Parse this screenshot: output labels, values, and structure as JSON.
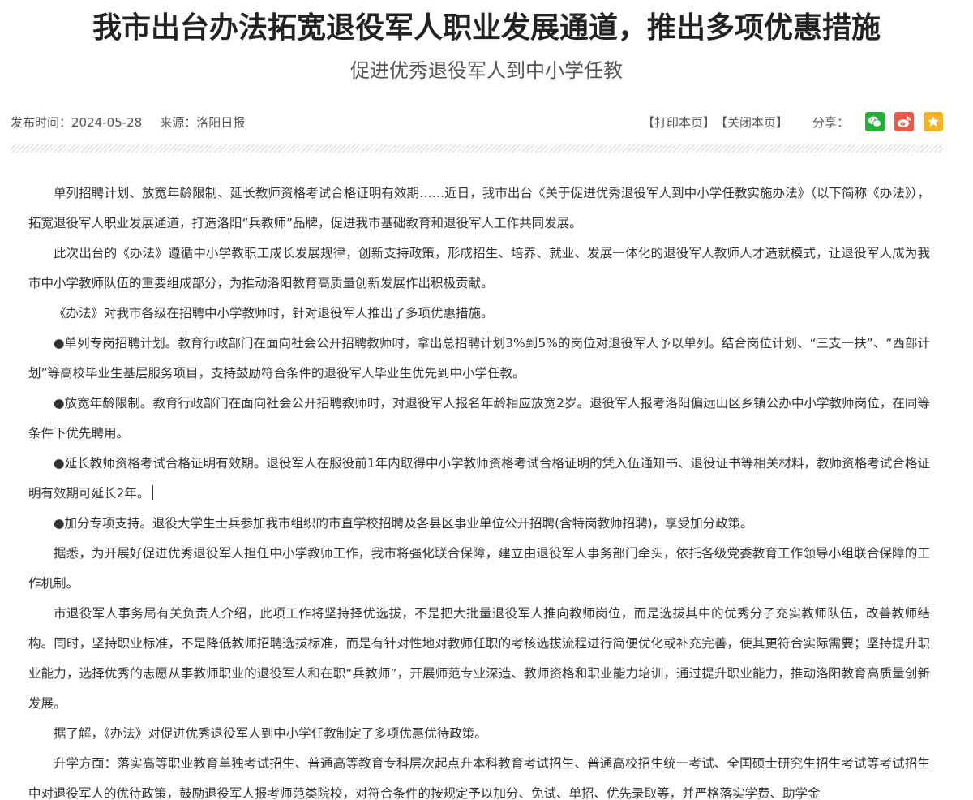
{
  "article": {
    "title": "我市出台办法拓宽退役军人职业发展通道，推出多项优惠措施",
    "subtitle": "促进优秀退役军人到中小学任教",
    "meta": {
      "publish_time": "发布时间：2024-05-28",
      "source": "来源：洛阳日报"
    },
    "actions": {
      "print": "【打印本页】",
      "close": "【关闭本页】",
      "share_label": "分享："
    },
    "paragraphs": [
      "单列招聘计划、放宽年龄限制、延长教师资格考试合格证明有效期……近日，我市出台《关于促进优秀退役军人到中小学任教实施办法》（以下简称《办法》），拓宽退役军人职业发展通道，打造洛阳“兵教师”品牌，促进我市基础教育和退役军人工作共同发展。",
      "此次出台的《办法》遵循中小学教职工成长发展规律，创新支持政策，形成招生、培养、就业、发展一体化的退役军人教师人才造就模式，让退役军人成为我市中小学教师队伍的重要组成部分，为推动洛阳教育高质量创新发展作出积极贡献。",
      "《办法》对我市各级在招聘中小学教师时，针对退役军人推出了多项优惠措施。",
      "●单列专岗招聘计划。教育行政部门在面向社会公开招聘教师时，拿出总招聘计划3%到5%的岗位对退役军人予以单列。结合岗位计划、“三支一扶”、“西部计划”等高校毕业生基层服务项目，支持鼓励符合条件的退役军人毕业生优先到中小学任教。",
      "●放宽年龄限制。教育行政部门在面向社会公开招聘教师时，对退役军人报名年龄相应放宽2岁。退役军人报考洛阳偏远山区乡镇公办中小学教师岗位，在同等条件下优先聘用。",
      "●延长教师资格考试合格证明有效期。退役军人在服役前1年内取得中小学教师资格考试合格证明的凭入伍通知书、退役证书等相关材料，教师资格考试合格证明有效期可延长2年。",
      "●加分专项支持。退役大学生士兵参加我市组织的市直学校招聘及各县区事业单位公开招聘(含特岗教师招聘)，享受加分政策。",
      "据悉，为开展好促进优秀退役军人担任中小学教师工作，我市将强化联合保障，建立由退役军人事务部门牵头，依托各级党委教育工作领导小组联合保障的工作机制。",
      "市退役军人事务局有关负责人介绍，此项工作将坚持择优选拔，不是把大批量退役军人推向教师岗位，而是选拔其中的优秀分子充实教师队伍，改善教师结构。同时，坚持职业标准，不是降低教师招聘选拔标准，而是有针对性地对教师任职的考核选拔流程进行简便优化或补充完善，使其更符合实际需要；坚持提升职业能力，选择优秀的志愿从事教师职业的退役军人和在职“兵教师”，开展师范专业深造、教师资格和职业能力培训，通过提升职业能力，推动洛阳教育高质量创新发展。",
      "据了解，《办法》对促进优秀退役军人到中小学任教制定了多项优惠优待政策。",
      "升学方面：落实高等职业教育单独考试招生、普通高等教育专科层次起点升本科教育考试招生、普通高校招生统一考试、全国硕士研究生招生考试等考试招生中对退役军人的优待政策，鼓励退役军人报考师范类院校，对符合条件的按规定予以加分、免试、单招、优先录取等，并严格落实学费、助学金"
    ]
  },
  "share_icons": [
    {
      "name": "wechat-icon",
      "color": "#2aae3a"
    },
    {
      "name": "weibo-icon",
      "color": "#e8594a"
    },
    {
      "name": "star-icon",
      "color": "#f0b429"
    }
  ]
}
